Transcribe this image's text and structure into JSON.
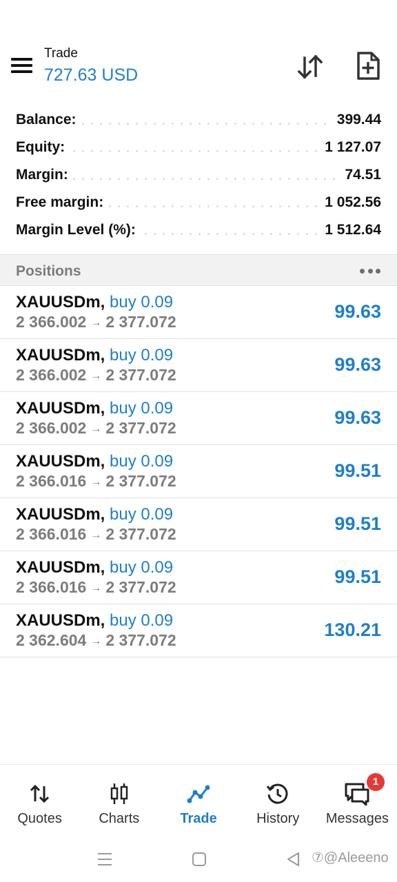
{
  "header": {
    "title": "Trade",
    "profit": "727.63 USD",
    "menu_icon": "hamburger-icon",
    "sort_icon": "sort-arrows-icon",
    "new_order_icon": "new-document-plus-icon"
  },
  "summary": [
    {
      "label": "Balance:",
      "value": "399.44"
    },
    {
      "label": "Equity:",
      "value": "1 127.07"
    },
    {
      "label": "Margin:",
      "value": "74.51"
    },
    {
      "label": "Free margin:",
      "value": "1 052.56"
    },
    {
      "label": "Margin Level (%):",
      "value": "1 512.64"
    }
  ],
  "positions": {
    "title": "Positions",
    "more_icon": "more-dots-icon",
    "items": [
      {
        "symbol": "XAUUSDm,",
        "type": "buy 0.09",
        "open_price": "2 366.002",
        "arrow": "→",
        "current_price": "2 377.072",
        "profit": "99.63"
      },
      {
        "symbol": "XAUUSDm,",
        "type": "buy 0.09",
        "open_price": "2 366.002",
        "arrow": "→",
        "current_price": "2 377.072",
        "profit": "99.63"
      },
      {
        "symbol": "XAUUSDm,",
        "type": "buy 0.09",
        "open_price": "2 366.002",
        "arrow": "→",
        "current_price": "2 377.072",
        "profit": "99.63"
      },
      {
        "symbol": "XAUUSDm,",
        "type": "buy 0.09",
        "open_price": "2 366.016",
        "arrow": "→",
        "current_price": "2 377.072",
        "profit": "99.51"
      },
      {
        "symbol": "XAUUSDm,",
        "type": "buy 0.09",
        "open_price": "2 366.016",
        "arrow": "→",
        "current_price": "2 377.072",
        "profit": "99.51"
      },
      {
        "symbol": "XAUUSDm,",
        "type": "buy 0.09",
        "open_price": "2 366.016",
        "arrow": "→",
        "current_price": "2 377.072",
        "profit": "99.51"
      },
      {
        "symbol": "XAUUSDm,",
        "type": "buy 0.09",
        "open_price": "2 362.604",
        "arrow": "→",
        "current_price": "2 377.072",
        "profit": "130.21"
      }
    ]
  },
  "nav": {
    "items": [
      {
        "label": "Quotes",
        "icon": "quotes-arrows-icon"
      },
      {
        "label": "Charts",
        "icon": "candlestick-icon"
      },
      {
        "label": "Trade",
        "icon": "trade-line-icon",
        "active": true
      },
      {
        "label": "History",
        "icon": "history-clock-icon"
      },
      {
        "label": "Messages",
        "icon": "chat-bubbles-icon",
        "badge": "1"
      }
    ]
  },
  "system_bar": {
    "watermark": "⑦@Aleeeno"
  },
  "colors": {
    "accent": "#1f7fc8",
    "badge": "#e53935",
    "muted": "#7c7c7c"
  }
}
